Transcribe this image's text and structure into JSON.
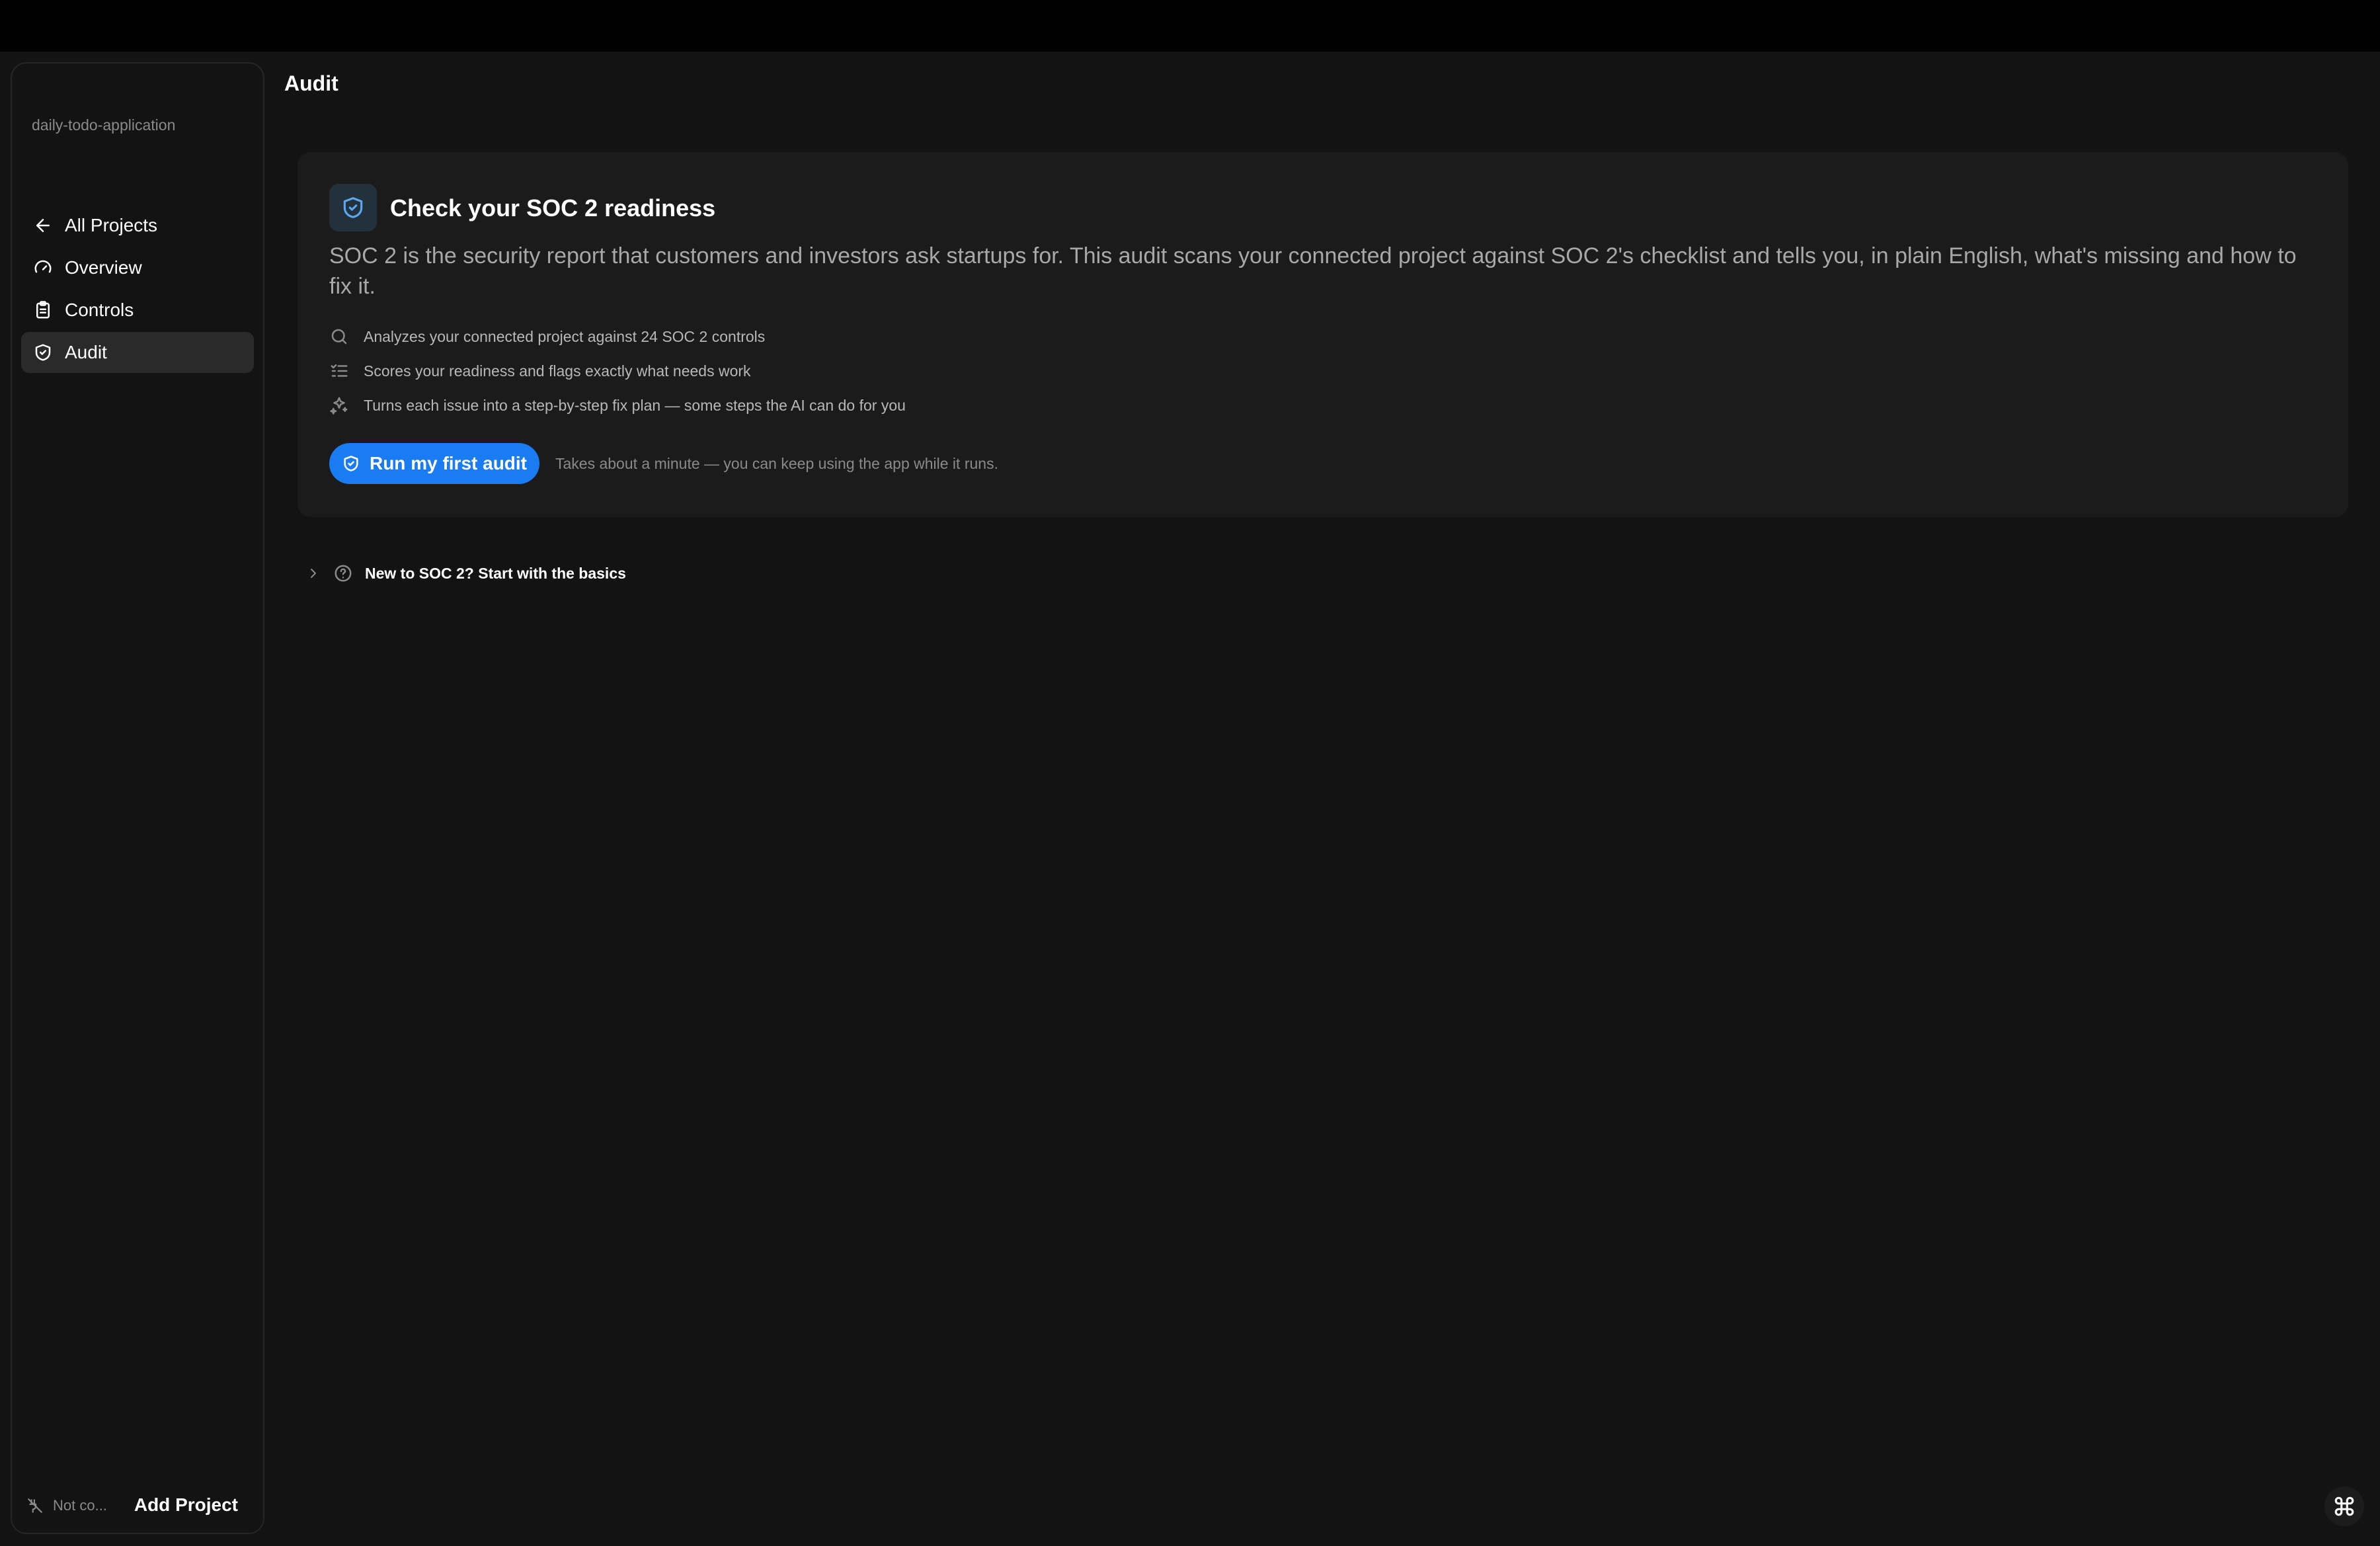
{
  "sidebar": {
    "project_name": "daily-todo-application",
    "items": [
      {
        "label": "All Projects",
        "icon": "arrow-left-icon"
      },
      {
        "label": "Overview",
        "icon": "gauge-icon"
      },
      {
        "label": "Controls",
        "icon": "clipboard-icon"
      },
      {
        "label": "Audit",
        "icon": "shield-check-icon",
        "active": true
      }
    ],
    "footer": {
      "status": "Not co...",
      "status_icon": "disconnected-plug-icon",
      "add_project": "Add Project"
    }
  },
  "header": {
    "title": "Audit"
  },
  "card": {
    "icon": "shield-check-icon",
    "title": "Check your SOC 2 readiness",
    "description": "SOC 2 is the security report that customers and investors ask startups for. This audit scans your connected project against SOC 2's checklist and tells you, in plain English, what's missing and how to fix it.",
    "features": [
      {
        "icon": "search-icon",
        "text": "Analyzes your connected project against 24 SOC 2 controls"
      },
      {
        "icon": "checklist-icon",
        "text": "Scores your readiness and flags exactly what needs work"
      },
      {
        "icon": "sparkles-icon",
        "text": "Turns each issue into a step-by-step fix plan — some steps the AI can do for you"
      }
    ],
    "button_label": "Run my first audit",
    "hint": "Takes about a minute — you can keep using the app while it runs."
  },
  "basics": {
    "label": "New to SOC 2? Start with the basics"
  },
  "colors": {
    "accent": "#1a7cf2",
    "background": "#131313",
    "card": "#1b1b1b"
  }
}
